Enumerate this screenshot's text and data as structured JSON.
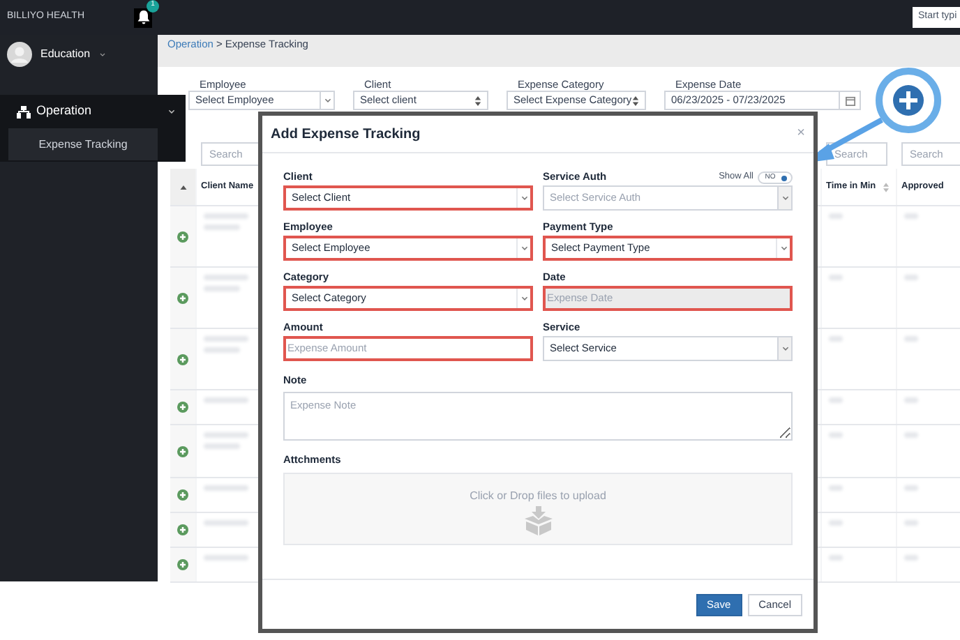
{
  "topbar": {
    "brand": "BILLIYO HEALTH",
    "notification_count": "1",
    "search_text": "Start typi"
  },
  "user": {
    "name": "Education"
  },
  "sidebar": {
    "section": {
      "label": "Operation",
      "expanded": true,
      "children": [
        {
          "label": "Expense Tracking",
          "selected": true
        }
      ]
    }
  },
  "breadcrumb": {
    "items": [
      {
        "label": "Operation",
        "link": true
      },
      {
        "label": "Expense Tracking",
        "link": false
      }
    ],
    "separator": ">"
  },
  "filters": [
    {
      "label": "Employee",
      "text": "Select Employee",
      "kind": "select"
    },
    {
      "label": "Client",
      "text": "Select client",
      "kind": "sort-select"
    },
    {
      "label": "Expense Category",
      "text": "Select Expense Category",
      "kind": "sort-select"
    },
    {
      "label": "Expense Date",
      "text": "06/23/2025 - 07/23/2025",
      "kind": "date"
    }
  ],
  "table": {
    "search_placeholders": [
      "Search",
      "Search",
      "Search"
    ],
    "columns": [
      {
        "label": "Client Name"
      },
      {
        "label": "Time in Min",
        "sortable": true
      },
      {
        "label": "Approved"
      }
    ],
    "rows": [
      {
        "kind": "tall"
      },
      {
        "kind": "tall"
      },
      {
        "kind": "tall"
      },
      {
        "kind": "short"
      },
      {
        "kind": "medium"
      },
      {
        "kind": "short"
      },
      {
        "kind": "short"
      },
      {
        "kind": "short"
      }
    ]
  },
  "modal": {
    "title": "Add Expense Tracking",
    "close": "×",
    "fields": [
      {
        "label": "Client",
        "placeholder": "Select Client",
        "kind": "select",
        "invalid": true,
        "disabled": false
      },
      {
        "label": "Service Auth",
        "placeholder": "Select Service Auth",
        "kind": "select",
        "invalid": false,
        "disabled": true,
        "toggle": {
          "label": "Show All",
          "text": "NO",
          "on": false
        }
      },
      {
        "label": "Employee",
        "placeholder": "Select Employee",
        "kind": "select",
        "invalid": true,
        "disabled": false
      },
      {
        "label": "Payment Type",
        "placeholder": "Select Payment Type",
        "kind": "select",
        "invalid": true,
        "disabled": false
      },
      {
        "label": "Category",
        "placeholder": "Select Category",
        "kind": "select",
        "invalid": true,
        "disabled": false
      },
      {
        "label": "Date",
        "placeholder": "Expense Date",
        "kind": "input",
        "invalid": true,
        "disabled": true
      },
      {
        "label": "Amount",
        "placeholder": "Expense Amount",
        "kind": "input",
        "invalid": true,
        "disabled": false
      },
      {
        "label": "Service",
        "placeholder": "Select Service",
        "kind": "select",
        "invalid": false,
        "disabled": false
      }
    ],
    "note": {
      "label": "Note",
      "placeholder": "Expense Note"
    },
    "attachments": {
      "label": "Attchments",
      "hint": "Click or Drop files to upload"
    },
    "buttons": [
      {
        "label": "Save",
        "kind": "primary"
      },
      {
        "label": "Cancel",
        "kind": "secondary"
      }
    ]
  }
}
